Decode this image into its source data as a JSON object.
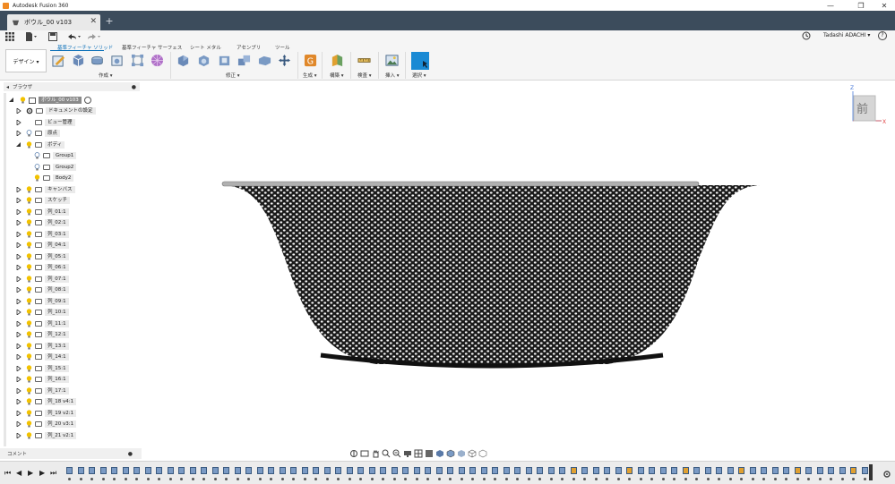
{
  "window": {
    "app_title": "Autodesk Fusion 360",
    "minimize": "—",
    "maximize": "❐",
    "close": "✕"
  },
  "document_tab": {
    "label": "ボウル_00 v103",
    "close": "✕",
    "add": "+"
  },
  "user": {
    "name": "Tadashi ADACHI ▾",
    "help": "?"
  },
  "ribbon": {
    "workspace": "デザイン ▾",
    "tabs": [
      "基準フィーチャ ソリッド",
      "基準フィーチャ サーフェス",
      "シート メタル",
      "アセンブリ",
      "ツール"
    ],
    "groups": [
      "作成 ▾",
      "修正 ▾",
      "生成 ▾",
      "構築 ▾",
      "検査 ▾",
      "挿入 ▾",
      "選択 ▾"
    ]
  },
  "browser": {
    "title": "ブラウザ",
    "root": "ボウル_00 v103",
    "nodes": [
      {
        "label": "ドキュメントの設定"
      },
      {
        "label": "ビュー管理"
      },
      {
        "label": "原点"
      },
      {
        "label": "ボディ"
      },
      {
        "label": "Group1"
      },
      {
        "label": "Group2"
      },
      {
        "label": "Body2"
      },
      {
        "label": "キャンバス"
      },
      {
        "label": "スケッチ"
      },
      {
        "label": "列_01:1"
      },
      {
        "label": "列_02:1"
      },
      {
        "label": "列_03:1"
      },
      {
        "label": "列_04:1"
      },
      {
        "label": "列_05:1"
      },
      {
        "label": "列_06:1"
      },
      {
        "label": "列_07:1"
      },
      {
        "label": "列_08:1"
      },
      {
        "label": "列_09:1"
      },
      {
        "label": "列_10:1"
      },
      {
        "label": "列_11:1"
      },
      {
        "label": "列_12:1"
      },
      {
        "label": "列_13:1"
      },
      {
        "label": "列_14:1"
      },
      {
        "label": "列_15:1"
      },
      {
        "label": "列_16:1"
      },
      {
        "label": "列_17:1"
      },
      {
        "label": "列_18 v4:1"
      },
      {
        "label": "列_19 v2:1"
      },
      {
        "label": "列_20 v3:1"
      },
      {
        "label": "列_21 v2:1"
      }
    ]
  },
  "comments": {
    "label": "コメント"
  },
  "viewcube": {
    "face": "前",
    "axis_z": "Z",
    "axis_x": "X"
  },
  "colors": {
    "tabbar": "#3c4c5c",
    "accent": "#0a6fb8",
    "bulb": "#f2c200"
  }
}
